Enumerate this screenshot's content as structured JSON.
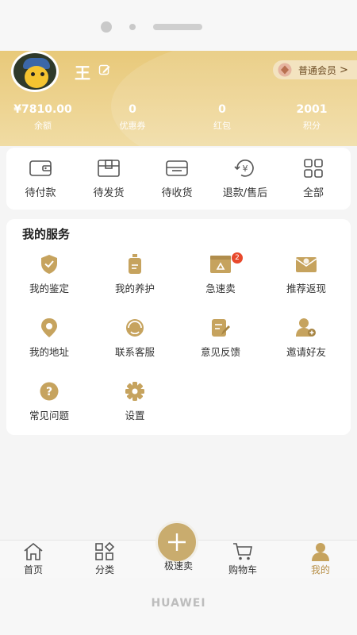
{
  "profile": {
    "name": "王",
    "member_label": "普通会员",
    "member_chevron": ">"
  },
  "stats": [
    {
      "value": "¥7810.00",
      "label": "余额"
    },
    {
      "value": "0",
      "label": "优惠券"
    },
    {
      "value": "0",
      "label": "红包"
    },
    {
      "value": "2001",
      "label": "积分"
    }
  ],
  "orders": [
    {
      "label": "待付款",
      "icon": "wallet-icon"
    },
    {
      "label": "待发货",
      "icon": "package-icon"
    },
    {
      "label": "待收货",
      "icon": "inbox-icon"
    },
    {
      "label": "退款/售后",
      "icon": "refund-icon"
    },
    {
      "label": "全部",
      "icon": "grid-icon"
    }
  ],
  "services": {
    "title": "我的服务",
    "items": [
      {
        "label": "我的鉴定",
        "icon": "shield-check-icon"
      },
      {
        "label": "我的养护",
        "icon": "care-bottle-icon"
      },
      {
        "label": "急速卖",
        "icon": "recycle-box-icon",
        "badge": "2"
      },
      {
        "label": "推荐返现",
        "icon": "envelope-icon"
      },
      {
        "label": "我的地址",
        "icon": "location-pin-icon"
      },
      {
        "label": "联系客服",
        "icon": "customer-service-icon"
      },
      {
        "label": "意见反馈",
        "icon": "feedback-icon"
      },
      {
        "label": "邀请好友",
        "icon": "add-friend-icon"
      },
      {
        "label": "常见问题",
        "icon": "question-icon"
      },
      {
        "label": "设置",
        "icon": "gear-icon"
      }
    ]
  },
  "nav": {
    "items": [
      {
        "label": "首页",
        "icon": "home-icon"
      },
      {
        "label": "分类",
        "icon": "category-icon"
      },
      {
        "label": "极速卖",
        "icon": "plus-icon"
      },
      {
        "label": "购物车",
        "icon": "cart-icon"
      },
      {
        "label": "我的",
        "icon": "user-icon",
        "active": true
      }
    ]
  },
  "device": {
    "brand": "HUAWEI"
  },
  "colors": {
    "accent": "#c9ac6e",
    "header": "#e8c97a",
    "icon_gold": "#c6a35e",
    "badge": "#e8492c",
    "active_nav": "#b8914a"
  }
}
